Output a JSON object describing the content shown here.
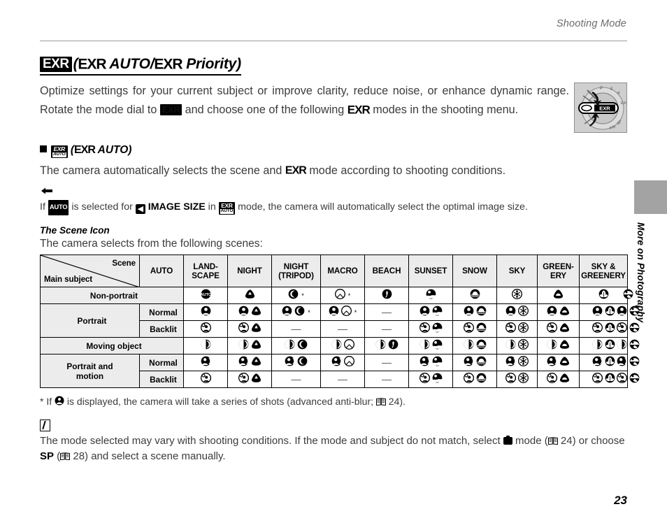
{
  "header": {
    "running_title": "Shooting Mode"
  },
  "title": {
    "badge": "EXR",
    "text_open": "(",
    "exr1": "EXR",
    "mid": " AUTO/",
    "exr2": "EXR",
    "tail": " Priority)"
  },
  "intro": {
    "part1": "Optimize settings for your current subject or improve clarity, reduce noise, or enhance dynamic range.  Rotate the mode dial to ",
    "badge1": "EXR",
    "part2": " and choose one of the following ",
    "badge2": "EXR",
    "part3": " modes in the shooting menu."
  },
  "section": {
    "heading_open": "(",
    "heading_exr": "EXR",
    "heading_tail": " AUTO)",
    "badge_line1": "EXR",
    "badge_line2": "AUTO",
    "body_part1": "The camera automatically selects the scene and ",
    "body_exr": "EXR",
    "body_part2": " mode according to shooting conditions."
  },
  "tip": {
    "icon": "pointing-hand-icon",
    "part1": "If ",
    "auto_chip": "AUTO",
    "part2": " is selected for ",
    "bold_label": "IMAGE SIZE",
    "part3": " in ",
    "badge_line1": "EXR",
    "badge_line2": "AUTO",
    "part4": " mode, the camera will automatically select the optimal image size."
  },
  "scene_section": {
    "heading": "The Scene Icon",
    "subtitle": "The camera selects from the following scenes:"
  },
  "table": {
    "corner": {
      "scene_label": "Scene",
      "main_label": "Main subject"
    },
    "columns": [
      "AUTO",
      "LAND-\nSCAPE",
      "NIGHT",
      "NIGHT\n(TRIPOD)",
      "MACRO",
      "BEACH",
      "SUNSET",
      "SNOW",
      "SKY",
      "GREEN-\nERY",
      "SKY &\nGREENERY"
    ],
    "rows": [
      {
        "label": "Non-portrait",
        "sub": null,
        "cells": [
          {
            "icons": [
              "auto"
            ],
            "star": false
          },
          {
            "icons": [
              "landscape"
            ],
            "star": false
          },
          {
            "icons": [
              "night"
            ],
            "star": true
          },
          {
            "icons": [
              "night-tripod"
            ],
            "star": true
          },
          {
            "icons": [
              "macro"
            ],
            "star": false
          },
          {
            "icons": [
              "beach"
            ],
            "star": false
          },
          {
            "icons": [
              "sunset"
            ],
            "star": false
          },
          {
            "icons": [
              "snow"
            ],
            "star": false
          },
          {
            "icons": [
              "sky"
            ],
            "star": false
          },
          {
            "icons": [
              "greenery"
            ],
            "star": false
          },
          {
            "icons": [
              "sky-greenery"
            ],
            "star": false
          }
        ]
      },
      {
        "label": "Portrait",
        "sub": "Normal",
        "cells": [
          {
            "icons": [
              "portrait"
            ],
            "star": false
          },
          {
            "icons": [
              "portrait",
              "landscape"
            ],
            "star": false
          },
          {
            "icons": [
              "portrait",
              "night"
            ],
            "star": true
          },
          {
            "icons": [
              "portrait",
              "night-tripod"
            ],
            "star": true
          },
          {
            "icons": [],
            "star": false
          },
          {
            "icons": [
              "portrait",
              "beach"
            ],
            "star": false
          },
          {
            "icons": [
              "portrait",
              "sunset"
            ],
            "star": false
          },
          {
            "icons": [
              "portrait",
              "snow"
            ],
            "star": false
          },
          {
            "icons": [
              "portrait",
              "sky"
            ],
            "star": false
          },
          {
            "icons": [
              "portrait",
              "greenery"
            ],
            "star": false
          },
          {
            "icons": [
              "portrait",
              "sky-greenery"
            ],
            "star": false
          }
        ]
      },
      {
        "label": "Portrait",
        "sub": "Backlit",
        "cells": [
          {
            "icons": [
              "backlit"
            ],
            "star": false
          },
          {
            "icons": [
              "backlit",
              "landscape"
            ],
            "star": false
          },
          {
            "icons": [],
            "star": false
          },
          {
            "icons": [],
            "star": false
          },
          {
            "icons": [],
            "star": false
          },
          {
            "icons": [
              "backlit",
              "beach"
            ],
            "star": false
          },
          {
            "icons": [
              "backlit",
              "sunset"
            ],
            "star": false
          },
          {
            "icons": [
              "backlit",
              "snow"
            ],
            "star": false
          },
          {
            "icons": [
              "backlit",
              "sky"
            ],
            "star": false
          },
          {
            "icons": [
              "backlit",
              "greenery"
            ],
            "star": false
          },
          {
            "icons": [
              "backlit",
              "sky-greenery"
            ],
            "star": false
          }
        ]
      },
      {
        "label": "Moving object",
        "sub": null,
        "cells": [
          {
            "icons": [
              "moving"
            ],
            "star": false
          },
          {
            "icons": [
              "moving",
              "landscape"
            ],
            "star": false
          },
          {
            "icons": [
              "moving",
              "night"
            ],
            "star": false
          },
          {
            "icons": [
              "moving",
              "night-tripod"
            ],
            "star": false
          },
          {
            "icons": [
              "moving",
              "macro"
            ],
            "star": false
          },
          {
            "icons": [
              "moving",
              "beach"
            ],
            "star": false
          },
          {
            "icons": [
              "moving",
              "sunset"
            ],
            "star": false
          },
          {
            "icons": [
              "moving",
              "snow"
            ],
            "star": false
          },
          {
            "icons": [
              "moving",
              "sky"
            ],
            "star": false
          },
          {
            "icons": [
              "moving",
              "greenery"
            ],
            "star": false
          },
          {
            "icons": [
              "moving",
              "sky-greenery"
            ],
            "star": false
          }
        ]
      },
      {
        "label": "Portrait and\nmotion",
        "sub": "Normal",
        "cells": [
          {
            "icons": [
              "portrait-motion"
            ],
            "star": false
          },
          {
            "icons": [
              "portrait-motion",
              "landscape"
            ],
            "star": false
          },
          {
            "icons": [
              "portrait-motion",
              "night"
            ],
            "star": false
          },
          {
            "icons": [
              "portrait-motion",
              "night-tripod"
            ],
            "star": false
          },
          {
            "icons": [],
            "star": false
          },
          {
            "icons": [
              "portrait-motion",
              "beach"
            ],
            "star": false
          },
          {
            "icons": [
              "portrait-motion",
              "sunset"
            ],
            "star": false
          },
          {
            "icons": [
              "portrait-motion",
              "snow"
            ],
            "star": false
          },
          {
            "icons": [
              "portrait-motion",
              "sky"
            ],
            "star": false
          },
          {
            "icons": [
              "portrait-motion",
              "greenery"
            ],
            "star": false
          },
          {
            "icons": [
              "portrait-motion",
              "sky-greenery"
            ],
            "star": false
          }
        ]
      },
      {
        "label": "Portrait and\nmotion",
        "sub": "Backlit",
        "cells": [
          {
            "icons": [
              "backlit-motion"
            ],
            "star": false
          },
          {
            "icons": [
              "backlit-motion",
              "landscape"
            ],
            "star": false
          },
          {
            "icons": [],
            "star": false
          },
          {
            "icons": [],
            "star": false
          },
          {
            "icons": [],
            "star": false
          },
          {
            "icons": [
              "backlit-motion",
              "beach"
            ],
            "star": false
          },
          {
            "icons": [
              "backlit-motion",
              "sunset"
            ],
            "star": false
          },
          {
            "icons": [
              "backlit-motion",
              "snow"
            ],
            "star": false
          },
          {
            "icons": [
              "backlit-motion",
              "sky"
            ],
            "star": false
          },
          {
            "icons": [
              "backlit-motion",
              "greenery"
            ],
            "star": false
          },
          {
            "icons": [
              "backlit-motion",
              "sky-greenery"
            ],
            "star": false
          }
        ]
      }
    ],
    "empty_mark": "—"
  },
  "footnote": {
    "star": "*",
    "part1": " If ",
    "part2": " is displayed, the camera will take a series of shots (advanced anti-blur; ",
    "page_ref": "24",
    "part3": ")."
  },
  "caution": {
    "part1": "The mode selected may vary with shooting conditions.  If the mode and subject do not match, select ",
    "part2": " mode (",
    "ref1": "24",
    "part3": ") or choose ",
    "bold_sp": "SP",
    "part4": " (",
    "ref2": "28",
    "part5": ") and select a scene manually."
  },
  "side": {
    "label": "More on Photography"
  },
  "page_number": "23",
  "colors": {
    "body_text": "#3c3c3c",
    "header_gray": "#6b6b6b",
    "table_header_bg": "#ececec",
    "side_tab": "#a3a3a3"
  }
}
